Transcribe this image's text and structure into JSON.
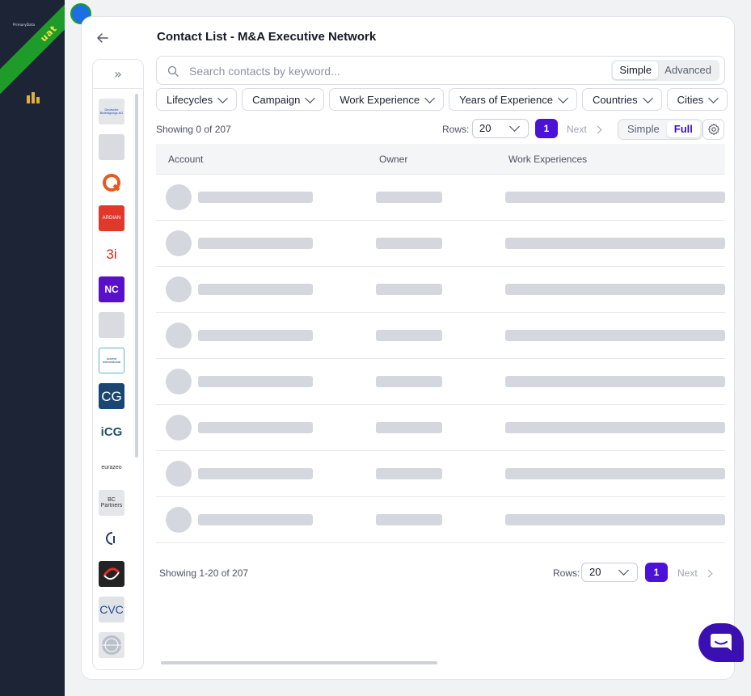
{
  "env_badge": "uat",
  "brand": "PrimaryData",
  "page_title": "Contact List - M&A Executive Network",
  "search": {
    "placeholder": "Search contacts by keyword...",
    "value": ""
  },
  "search_modes": [
    "Simple",
    "Advanced"
  ],
  "active_search_mode": "Simple",
  "filters": [
    "Lifecycles",
    "Campaign",
    "Work Experience",
    "Years of Experience",
    "Countries",
    "Cities"
  ],
  "top_pager": {
    "showing": "Showing 0 of 207",
    "rows_label": "Rows:",
    "rows_value": "20",
    "page": "1",
    "next": "Next"
  },
  "view_modes": [
    "Simple",
    "Full"
  ],
  "active_view_mode": "Full",
  "table": {
    "columns": [
      "Account",
      "Owner",
      "Work Experiences"
    ]
  },
  "bottom_pager": {
    "showing": "Showing 1-20 of 207",
    "rows_label": "Rows:",
    "rows_value": "20",
    "page": "1",
    "next": "Next"
  },
  "logos": [
    {
      "name": "deutsche-beteiligungs-logo",
      "text": "Deutsche Beteiligungs AG"
    },
    {
      "name": "grey-logo-2",
      "text": ""
    },
    {
      "name": "q-logo",
      "text": ""
    },
    {
      "name": "ardian-logo",
      "text": "ARDIAN"
    },
    {
      "name": "3i-logo",
      "text": "3i"
    },
    {
      "name": "nc-logo",
      "text": "NC"
    },
    {
      "name": "grey-logo-7",
      "text": ""
    },
    {
      "name": "advent-international-logo",
      "text": "Advent International"
    },
    {
      "name": "cg-logo",
      "text": "CG"
    },
    {
      "name": "icg-logo",
      "text": "iCG"
    },
    {
      "name": "eurazeo-logo",
      "text": "eurazeo"
    },
    {
      "name": "bc-partners-logo",
      "text": "BC Partners"
    },
    {
      "name": "bracket-logo",
      "text": ""
    },
    {
      "name": "swoosh-logo",
      "text": ""
    },
    {
      "name": "cvc-logo",
      "text": "CVC"
    },
    {
      "name": "globe-logo",
      "text": ""
    }
  ],
  "colors": {
    "accent": "#4b12d8",
    "nav_bg": "#1c2436",
    "skeleton": "#d4d8de",
    "ribbon": "#1f9b2a"
  }
}
